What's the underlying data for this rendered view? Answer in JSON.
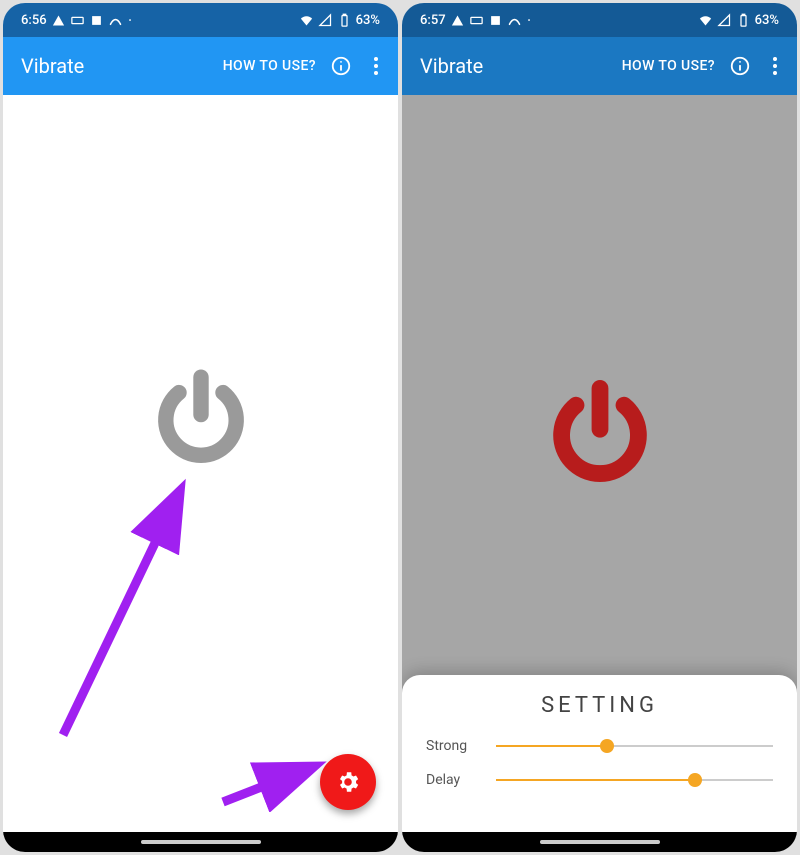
{
  "left": {
    "statusbar": {
      "time": "6:56",
      "battery": "63%"
    },
    "appbar": {
      "title": "Vibrate",
      "howto": "HOW TO USE?"
    },
    "power_color": "#9a9a9a",
    "fab": {
      "icon": "gear"
    }
  },
  "right": {
    "statusbar": {
      "time": "6:57",
      "battery": "63%"
    },
    "appbar": {
      "title": "Vibrate",
      "howto": "HOW TO USE?"
    },
    "power_color": "#b71c1c",
    "sheet": {
      "title": "SETTING",
      "sliders": [
        {
          "label": "Strong",
          "value": 40
        },
        {
          "label": "Delay",
          "value": 72
        }
      ]
    }
  }
}
